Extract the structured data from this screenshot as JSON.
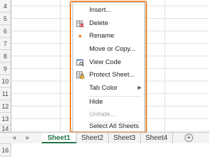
{
  "grid": {
    "rows": [
      "4",
      "5",
      "6",
      "7",
      "8",
      "9",
      "10",
      "11",
      "12",
      "13",
      "14",
      "15",
      "16"
    ]
  },
  "context_menu": {
    "items": [
      {
        "label": "Insert...",
        "icon": "insert-icon",
        "enabled": true
      },
      {
        "label": "Delete",
        "icon": "delete-sheet-icon",
        "enabled": true
      },
      {
        "label": "Rename",
        "icon": "rename-icon",
        "enabled": true
      },
      {
        "label": "Move or Copy...",
        "icon": "",
        "enabled": true
      },
      {
        "label": "View Code",
        "icon": "view-code-icon",
        "enabled": true
      },
      {
        "label": "Protect Sheet...",
        "icon": "protect-sheet-icon",
        "enabled": true
      },
      {
        "label": "Tab Color",
        "icon": "",
        "enabled": true,
        "submenu": true
      },
      {
        "label": "Hide",
        "icon": "",
        "enabled": true
      },
      {
        "label": "Unhide...",
        "icon": "",
        "enabled": false
      },
      {
        "label": "Select All Sheets",
        "icon": "",
        "enabled": true
      }
    ],
    "highlight_color": "#F08C3C"
  },
  "tabbar": {
    "active_sheet": "Sheet1",
    "sheets": [
      "Sheet1",
      "Sheet2",
      "Sheet3",
      "Sheet4"
    ],
    "accent_color": "#1F7244"
  }
}
